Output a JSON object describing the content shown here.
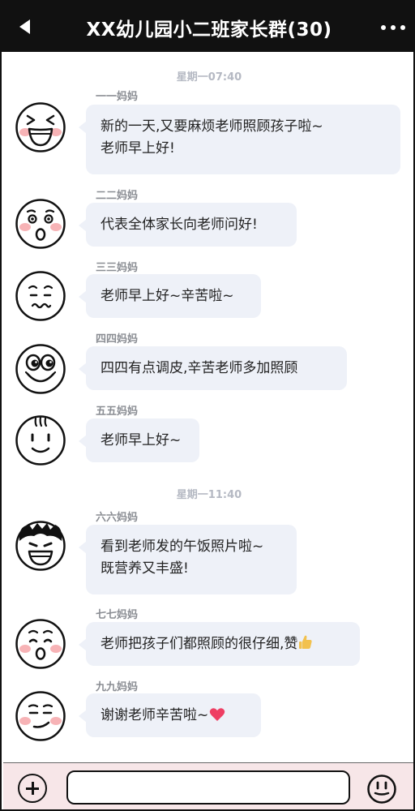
{
  "header": {
    "title": "XX幼儿园小二班家长群(30)"
  },
  "chat": {
    "timestamps": [
      "星期一07:40",
      "星期一11:40"
    ],
    "messages": [
      {
        "sender": "一一妈妈",
        "lines": [
          "新的一天,又要麻烦老师照顾孩子啦~",
          "老师早上好!"
        ],
        "avatar": "laughing-face-icon"
      },
      {
        "sender": "二二妈妈",
        "lines": [
          "代表全体家长向老师问好!"
        ],
        "avatar": "surprised-face-icon"
      },
      {
        "sender": "三三妈妈",
        "lines": [
          "老师早上好~辛苦啦~"
        ],
        "avatar": "wavy-smile-face-icon"
      },
      {
        "sender": "四四妈妈",
        "lines": [
          "四四有点调皮,辛苦老师多加照顾"
        ],
        "avatar": "big-eyes-face-icon"
      },
      {
        "sender": "五五妈妈",
        "lines": [
          "老师早上好~"
        ],
        "avatar": "hair-tuft-face-icon"
      },
      {
        "sender": "六六妈妈",
        "lines": [
          "看到老师发的午饭照片啦~",
          "既营养又丰盛!"
        ],
        "avatar": "spiky-hair-grin-face-icon"
      },
      {
        "sender": "七七妈妈",
        "lines": [
          "老师把孩子们都照顾的很仔细,赞"
        ],
        "avatar": "oh-face-icon",
        "trailing_icon": "thumbs-up-icon"
      },
      {
        "sender": "九九妈妈",
        "lines": [
          "谢谢老师辛苦啦~"
        ],
        "avatar": "smirk-face-icon",
        "trailing_icon": "heart-icon"
      }
    ]
  },
  "input": {
    "value": "",
    "placeholder": ""
  },
  "colors": {
    "header_bg": "#111111",
    "bubble_bg": "#eef1f8",
    "blush": "#f7b3b6",
    "input_bar_bg": "#f7e6e8",
    "heart": "#ee3e63",
    "thumbs_up": "#f2c14e"
  }
}
